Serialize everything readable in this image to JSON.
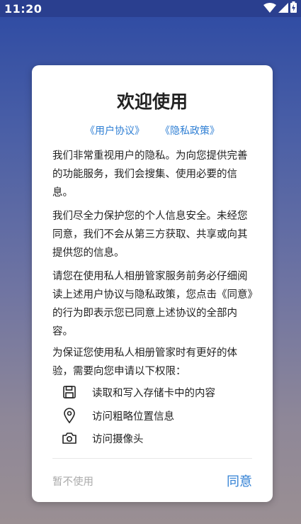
{
  "status_bar": {
    "time": "11:20"
  },
  "dialog": {
    "title": "欢迎使用",
    "links": {
      "user_agreement": "《用户协议》",
      "privacy_policy": "《隐私政策》"
    },
    "paragraphs": [
      "我们非常重视用户的隐私。为向您提供完善的功能服务，我们会搜集、使用必要的信息。",
      "我们尽全力保护您的个人信息安全。未经您同意，我们不会从第三方获取、共享或向其提供您的信息。",
      "请您在使用私人相册管家服务前务必仔细阅读上述用户协议与隐私政策，您点击《同意》的行为即表示您已同意上述协议的全部内容。",
      "为保证您使用私人相册管家时有更好的体验，需要向您申请以下权限："
    ],
    "permissions": [
      {
        "icon": "floppy-disk-icon",
        "label": "读取和写入存储卡中的内容"
      },
      {
        "icon": "location-pin-icon",
        "label": "访问粗略位置信息"
      },
      {
        "icon": "camera-icon",
        "label": "访问摄像头"
      }
    ],
    "buttons": {
      "cancel": "暂不使用",
      "agree": "同意"
    }
  },
  "colors": {
    "accent": "#2f7fd4",
    "status_bar": "#2a3f8f"
  }
}
